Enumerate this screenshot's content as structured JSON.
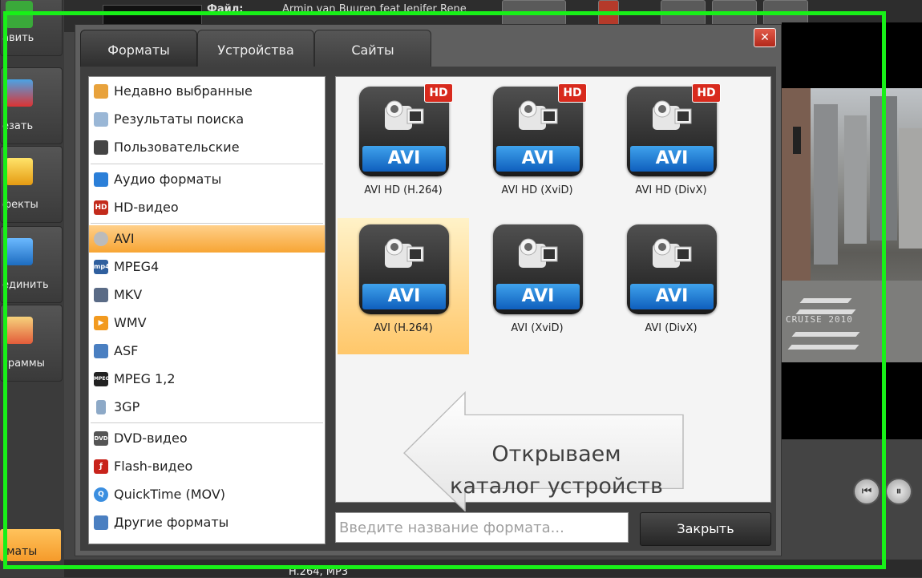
{
  "background": {
    "top_title": "Файл:",
    "top_track": "Armin van Buuren feat Jenifer Rene",
    "left_toolbar": [
      {
        "label": "авить",
        "icon": "plus-icon"
      },
      {
        "label": "езать",
        "icon": "scissors-icon"
      },
      {
        "label": "фекты",
        "icon": "magic-wand-icon"
      },
      {
        "label": "единить",
        "icon": "join-icon"
      },
      {
        "label": "граммы",
        "icon": "slideshow-icon"
      }
    ],
    "formats_tab": "маты",
    "video_overlay_text": "CRUISE 2010",
    "bottom_codec": "H.264, MP3"
  },
  "dialog": {
    "tabs": [
      {
        "label": "Форматы",
        "active": true
      },
      {
        "label": "Устройства",
        "active": false
      },
      {
        "label": "Сайты",
        "active": false
      }
    ],
    "close_icon": "close-icon",
    "categories": [
      {
        "label": "Недавно выбранные",
        "icon": "recent-icon"
      },
      {
        "label": "Результаты поиска",
        "icon": "search-icon"
      },
      {
        "label": "Пользовательские",
        "icon": "user-icon"
      },
      {
        "label": "Аудио форматы",
        "icon": "music-note-icon"
      },
      {
        "label": "HD-видео",
        "icon": "hd-icon",
        "badge": "HD"
      },
      {
        "label": "AVI",
        "icon": "film-reel-icon",
        "selected": true
      },
      {
        "label": "MPEG4",
        "icon": "mp4-icon",
        "badge": "mp4"
      },
      {
        "label": "MKV",
        "icon": "mkv-icon"
      },
      {
        "label": "WMV",
        "icon": "play-icon"
      },
      {
        "label": "ASF",
        "icon": "video-icon"
      },
      {
        "label": "MPEG 1,2",
        "icon": "mpeg-icon",
        "badge": "MPEG"
      },
      {
        "label": "3GP",
        "icon": "phone-icon"
      },
      {
        "label": "DVD-видео",
        "icon": "dvd-icon",
        "badge": "DVD"
      },
      {
        "label": "Flash-видео",
        "icon": "flash-icon"
      },
      {
        "label": "QuickTime (MOV)",
        "icon": "quicktime-icon"
      },
      {
        "label": "Другие форматы",
        "icon": "other-formats-icon"
      }
    ],
    "formats": [
      {
        "label": "AVI HD (H.264)",
        "bar": "AVI",
        "hd": "HD",
        "selected": false
      },
      {
        "label": "AVI HD (XviD)",
        "bar": "AVI",
        "hd": "HD",
        "selected": false
      },
      {
        "label": "AVI HD (DivX)",
        "bar": "AVI",
        "hd": "HD",
        "selected": false
      },
      {
        "label": "AVI (H.264)",
        "bar": "AVI",
        "hd": "",
        "selected": true
      },
      {
        "label": "AVI (XviD)",
        "bar": "AVI",
        "hd": "",
        "selected": false
      },
      {
        "label": "AVI (DivX)",
        "bar": "AVI",
        "hd": "",
        "selected": false
      }
    ],
    "search_placeholder": "Введите название формата...",
    "close_button": "Закрыть"
  },
  "callout": {
    "line1": "Открываем",
    "line2": "каталог устройств"
  },
  "colors": {
    "highlight_frame": "#18f018",
    "selection_orange": "#f7a534",
    "avi_blue": "#1a72d0",
    "hd_red": "#d82a1d"
  }
}
